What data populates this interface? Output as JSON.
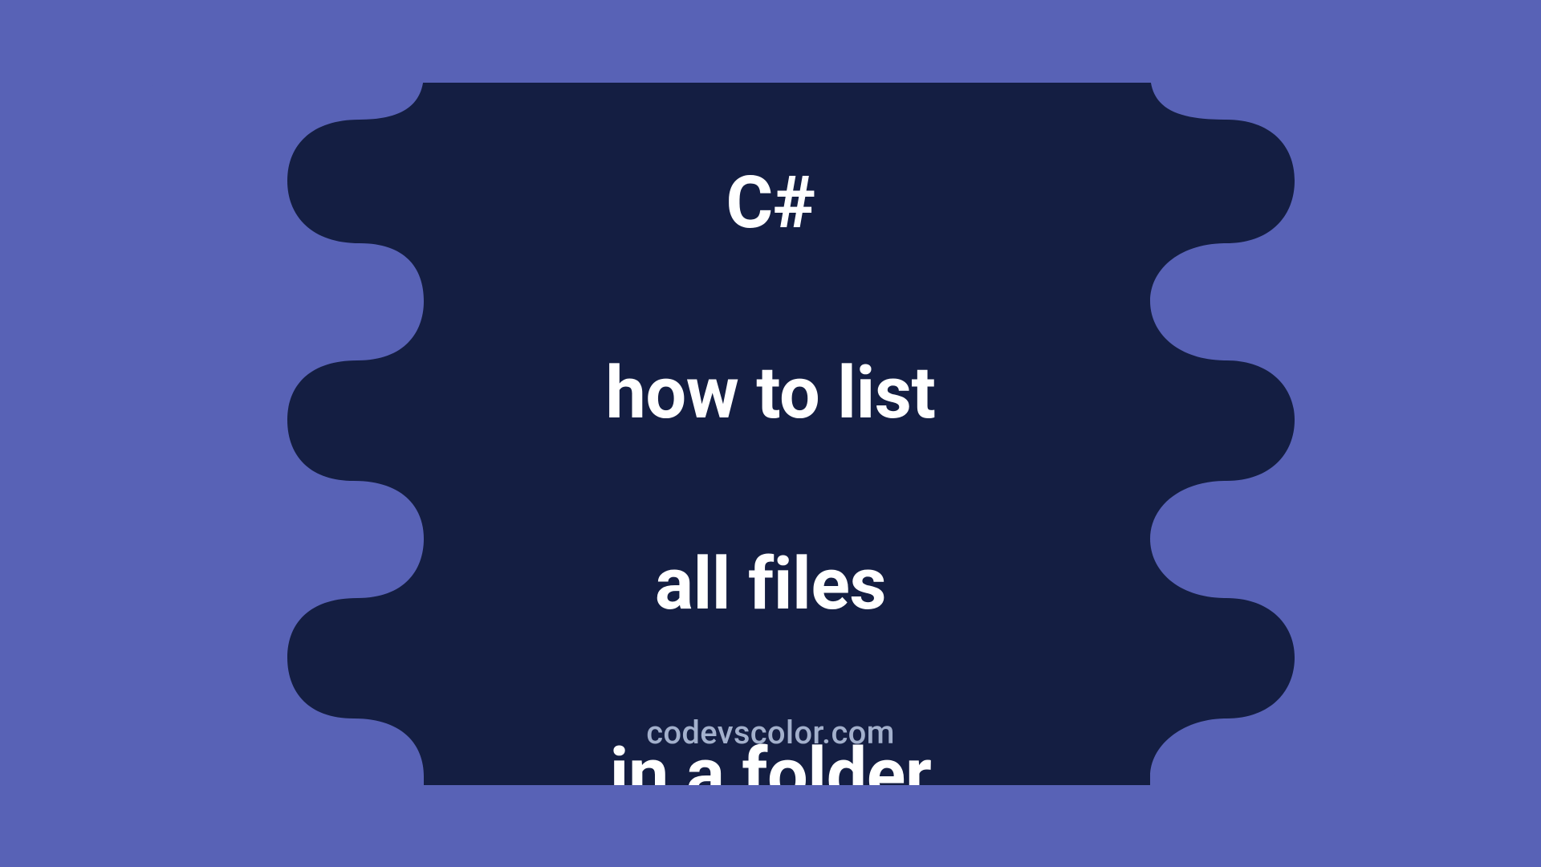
{
  "colors": {
    "bg_light": "#5862b6",
    "bg_dark": "#141e42",
    "text_white": "#ffffff",
    "text_muted": "#a3b0cc"
  },
  "title_lines": [
    "C#",
    "how to list",
    "all files",
    "in a folder"
  ],
  "site": "codevscolor.com"
}
